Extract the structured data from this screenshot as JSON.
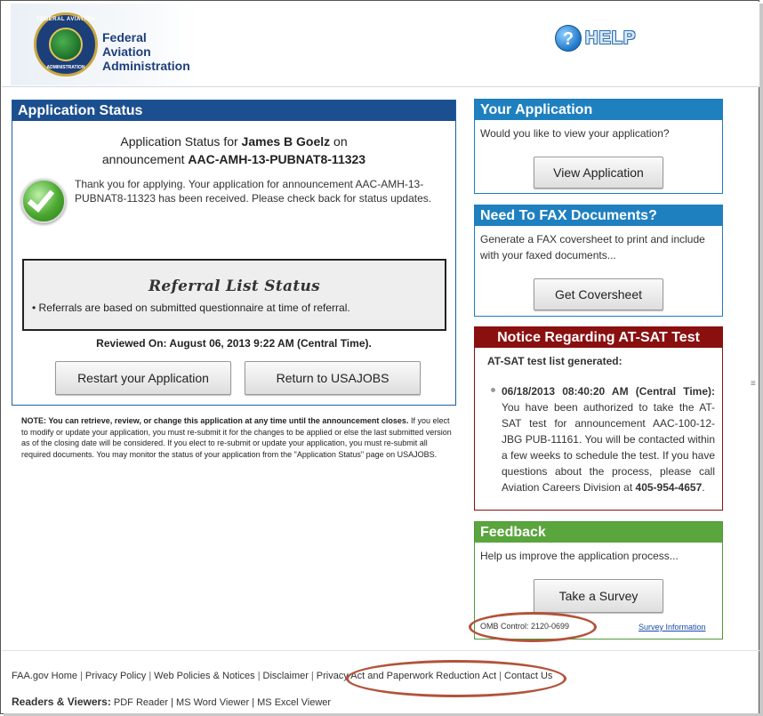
{
  "header": {
    "org_line1": "Federal Aviation",
    "org_line2": "Administration",
    "seal_top": "FEDERAL AVIATION",
    "seal_bottom": "ADMINISTRATION",
    "help_icon": "question-mark-icon",
    "help_label": "HELP"
  },
  "status": {
    "title": "Application Status",
    "line1_prefix": "Application Status for ",
    "applicant": "James B Goelz",
    "line1_suffix": " on",
    "line2_prefix": "announcement ",
    "announcement": "AAC-AMH-13-PUBNAT8-11323",
    "thanks": "Thank you for applying. Your application for announcement AAC-AMH-13-PUBNAT8-11323 has been received. Please check back for status updates.",
    "referral_title": "Referral List Status",
    "referral_bullet": "• Referrals are based on submitted questionnaire at time of referral.",
    "reviewed": "Reviewed On: August 06, 2013 9:22 AM (Central Time).",
    "restart_label": "Restart your Application",
    "return_label": "Return to USAJOBS"
  },
  "note": {
    "bold": "NOTE: You can retrieve, review, or change this application at any time until the announcement closes.",
    "rest": " If you elect to modify or update your application, you must re-submit it for the changes to be applied or else the last submitted version as of the closing date will be considered. If you elect to re-submit or update your application, you must re-submit all required documents. You may monitor the status of your application from the \"Application Status\" page on USAJOBS."
  },
  "your_application": {
    "title": "Your Application",
    "text": "Would you like to view your application?",
    "button": "View Application"
  },
  "fax": {
    "title": "Need To FAX Documents?",
    "text": "Generate a FAX coversheet to print and include with your faxed documents...",
    "button": "Get Coversheet"
  },
  "atsat": {
    "title": "Notice Regarding AT-SAT Test",
    "subtitle": "AT-SAT test list generated:",
    "item_date": "06/18/2013 08:40:20 AM (Central Time):",
    "item_body": " You have been authorized to take the AT-SAT test for announcement AAC-100-12-JBG PUB-11161. You will be contacted within a few weeks to schedule the test. If you have questions about the process, please call Aviation Careers Division at ",
    "phone": "405-954-4657",
    "item_end": "."
  },
  "feedback": {
    "title": "Feedback",
    "text": "Help us improve the application process...",
    "button": "Take a Survey",
    "omb": "OMB Control: 2120-0699",
    "survey_info": "Survey Information"
  },
  "footer": {
    "links": [
      "FAA.gov Home",
      "Privacy Policy",
      "Web Policies & Notices",
      "Disclaimer",
      "Privacy Act and Paperwork Reduction Act",
      "Contact Us"
    ],
    "readers_label": "Readers & Viewers:",
    "readers": [
      "PDF Reader",
      "MS Word Viewer",
      "MS Excel Viewer"
    ]
  },
  "colors": {
    "status_header": "#1c4f8f",
    "blue_header": "#1f80c0",
    "red_header": "#8a1010",
    "green_header": "#5aa53d",
    "annotation_oval": "#b2533a"
  }
}
